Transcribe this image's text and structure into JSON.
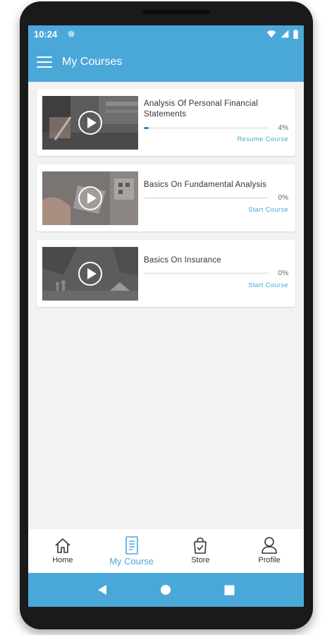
{
  "status_bar": {
    "time": "10:24"
  },
  "app_bar": {
    "title": "My Courses"
  },
  "courses": [
    {
      "title": "Analysis Of Personal Financial Statements",
      "progress_percent": 4,
      "progress_label": "4%",
      "action_label": "Resume Course"
    },
    {
      "title": "Basics On Fundamental Analysis",
      "progress_percent": 0,
      "progress_label": "0%",
      "action_label": "Start Course"
    },
    {
      "title": "Basics On Insurance",
      "progress_percent": 0,
      "progress_label": "0%",
      "action_label": "Start Course"
    }
  ],
  "bottom_nav": {
    "items": [
      {
        "label": "Home",
        "icon": "home-icon",
        "active": false
      },
      {
        "label": "My Course",
        "icon": "my-course-icon",
        "active": true
      },
      {
        "label": "Store",
        "icon": "store-bag-icon",
        "active": false
      },
      {
        "label": "Profile",
        "icon": "profile-icon",
        "active": false
      }
    ]
  },
  "colors": {
    "primary": "#4aa8d8",
    "progress": "#2f8fd0",
    "background": "#f2f2f2"
  }
}
